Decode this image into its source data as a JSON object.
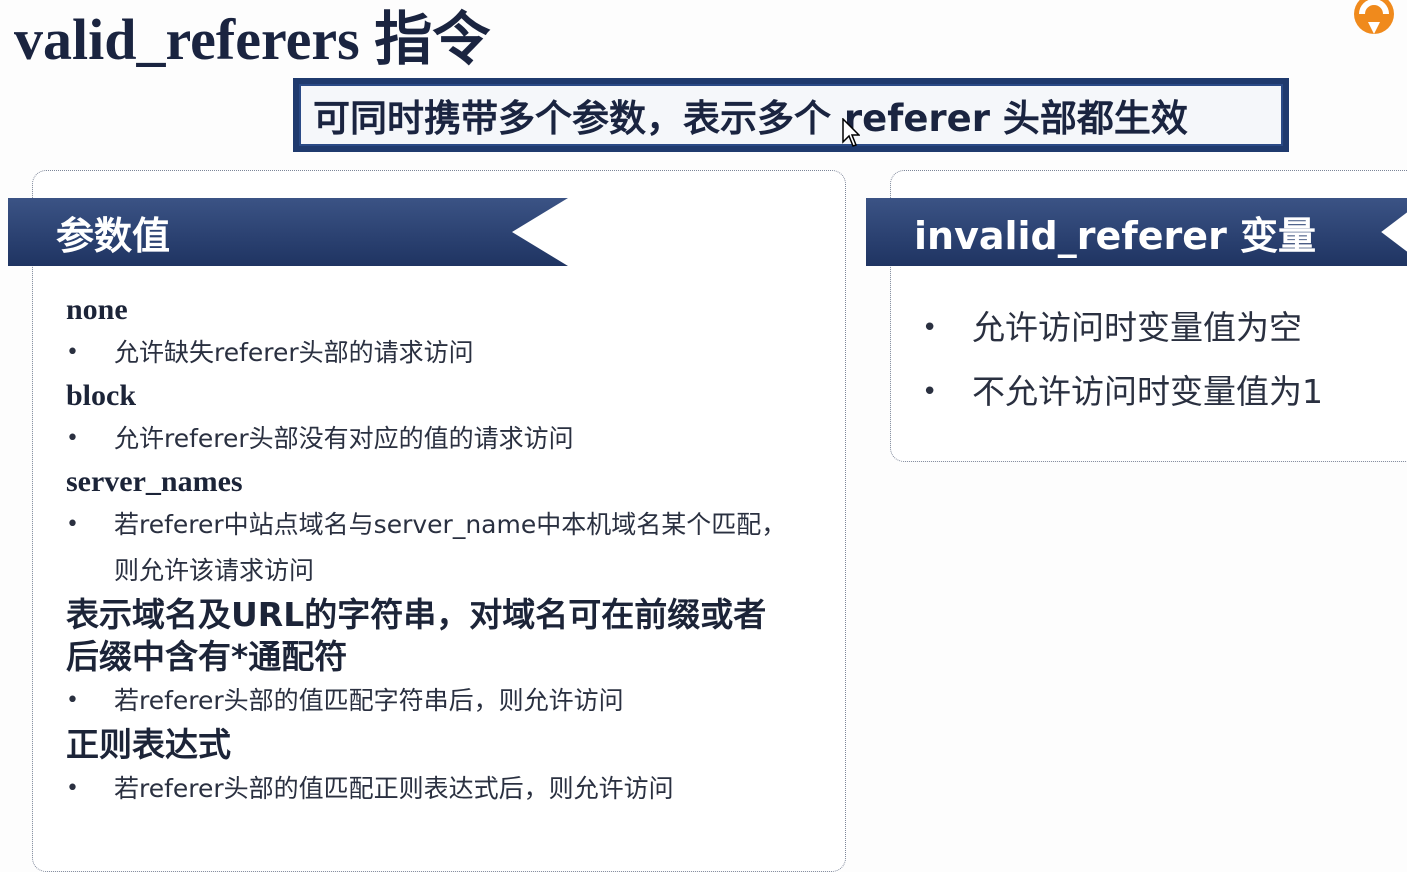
{
  "slide": {
    "title": "valid_referers 指令",
    "banner": "可同时携带多个参数，表示多个 referer 头部都生效",
    "left_panel": {
      "header": "参数值",
      "items": [
        {
          "term": "none",
          "bullets": [
            "允许缺失referer头部的请求访问"
          ]
        },
        {
          "term": "block",
          "bullets": [
            "允许referer头部没有对应的值的请求访问"
          ]
        },
        {
          "term": "server_names",
          "bullets": [
            "若referer中站点域名与server_name中本机域名某个匹配，",
            "则允许该请求访问"
          ]
        }
      ],
      "big_item_1": {
        "line1": "表示域名及URL的字符串，对域名可在前缀或者",
        "line2": "后缀中含有*通配符",
        "bullet": "若referer头部的值匹配字符串后，则允许访问"
      },
      "big_item_2": {
        "term": "正则表达式",
        "bullet": "若referer头部的值匹配正则表达式后，则允许访问"
      }
    },
    "right_panel": {
      "header": "invalid_referer 变量",
      "bullets": [
        "允许访问时变量值为空",
        "不允许访问时变量值为1"
      ]
    },
    "bullet_char": "•",
    "colors": {
      "ribbon": "#2b4577",
      "title": "#1a2440",
      "logo": "#f08a1c"
    }
  }
}
